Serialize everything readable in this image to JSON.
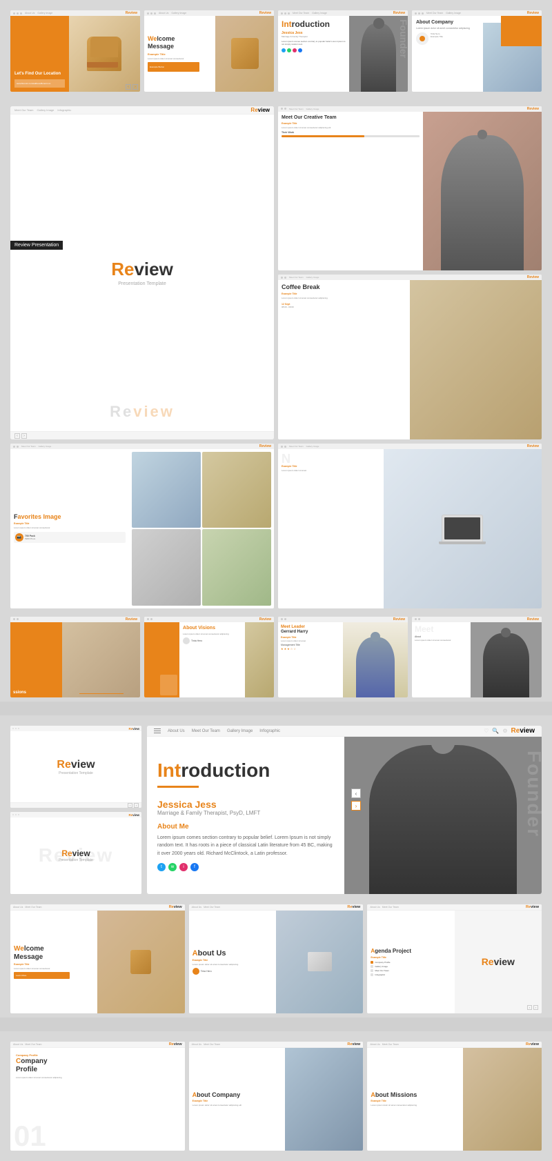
{
  "brand": {
    "name": "Review",
    "name_re": "Re",
    "name_view": "view",
    "tagline": "Presentation Template"
  },
  "section1": {
    "label": "Review Presentation",
    "slides": [
      {
        "id": "find-location",
        "title": "Let's Find Our Location",
        "nav": [
          "About Us",
          "Meet Our Team",
          "Gallery Image",
          "Infographic"
        ]
      },
      {
        "id": "welcome-message",
        "title": "Welcome Message",
        "subtitle": "We",
        "nav": [
          "About Us",
          "Meet Our Team",
          "Gallery Image",
          "Infographic"
        ]
      },
      {
        "id": "introduction",
        "title": "Introduction",
        "title_accent": "Int",
        "name": "Jessica Jess",
        "role": "Marriage & Family Therapist, PsyD, LMFT",
        "nav": [
          "About Us",
          "Meet Our Team",
          "Gallery Image",
          "Infographic"
        ]
      },
      {
        "id": "about-company-top",
        "title": "About Company",
        "nav": [
          "About Us",
          "Meet Our Team",
          "Gallery Image",
          "Infographic"
        ]
      }
    ]
  },
  "section2": {
    "slides": [
      {
        "id": "meet-creative-team",
        "title": "Meet Our Creative Team",
        "subtitle": "Example Title",
        "nav": [
          "About Us",
          "Meet Our Team",
          "Gallery Image",
          "Infographic"
        ]
      },
      {
        "id": "coffee-break",
        "title": "Coffee Break",
        "subtitle": "Example Title",
        "nav": [
          "About Us",
          "Meet Our Team",
          "Gallery Image",
          "Infographic"
        ]
      }
    ]
  },
  "section3": {
    "slides": [
      {
        "id": "favorites-image",
        "title": "Favorites Image",
        "subtitle": "Example Title",
        "nav": [
          "About Us",
          "Meet Our Team",
          "Gallery Image",
          "Infographic"
        ]
      },
      {
        "id": "laptop-slide",
        "title": "",
        "nav": [
          "About Us",
          "Meet Our Team",
          "Gallery Image",
          "Infographic"
        ]
      }
    ]
  },
  "section4": {
    "slides": [
      {
        "id": "missions",
        "title": "Missions",
        "nav": [
          "About Us",
          "Meet Our Team",
          "Gallery Image",
          "Infographic"
        ]
      },
      {
        "id": "about-visions",
        "title": "About Visions",
        "nav": [
          "About Us",
          "Meet Our Team",
          "Gallery Image",
          "Infographic"
        ]
      },
      {
        "id": "meet-leader",
        "title": "Meet Leader Gerrard Harry",
        "title_accent": "Meet Leader",
        "subtitle": "Example Title",
        "nav": [
          "About Us",
          "Meet Our Team",
          "Gallery Image",
          "Infographic"
        ]
      },
      {
        "id": "meet-side",
        "title": "Meet",
        "nav": [
          "About Us",
          "Meet Our Team",
          "Gallery Image",
          "Infographic"
        ]
      }
    ]
  },
  "large_preview": {
    "top_nav": [
      "About Us",
      "Meet Our Team",
      "Gallery Image",
      "Infographic"
    ],
    "review_slide": {
      "logo": "Review",
      "tagline": "Presentation Template"
    },
    "review_bottom": {
      "logo": "Review",
      "tagline": "Presentation Template"
    },
    "intro_slide": {
      "title_accent": "Int",
      "title_rest": "roduction",
      "name": "Jessica Jess",
      "role": "Marriage & Family Therapist, PsyD, LMFT",
      "about_label": "About Me",
      "about_text": "Lorem ipsum comes section contrary to popular belief. Lorem Ipsum is not simply random text. It has roots in a piece of classical Latin literature from 45 BC, making it over 2000 years old. Richard McClintock, a Latin professor.",
      "founder_text": "Founder"
    }
  },
  "bottom_row1": {
    "welcome": {
      "title_accent": "We",
      "title_rest": "lcome Message",
      "subtitle": "Example Title"
    },
    "about_us": {
      "title": "About Us",
      "title_accent": "A",
      "subtitle": "Example Title",
      "presenter": "Tinia Hero"
    },
    "agenda": {
      "title": "Agenda Project",
      "subtitle": "Example Title",
      "items": [
        "Company Profile",
        "Gallery Image",
        "Meet Our Team",
        "Infographic"
      ]
    }
  },
  "bottom_section": {
    "company_profile": {
      "number": "01",
      "label": "Company Profile",
      "title_accent": "C",
      "title_rest": "ompany Profile"
    },
    "about_company": {
      "title": "About Company",
      "title_accent": "A",
      "subtitle": "Example Title"
    },
    "about_missions": {
      "title": "About Missions",
      "title_accent": "A",
      "subtitle": "Example Title"
    }
  }
}
